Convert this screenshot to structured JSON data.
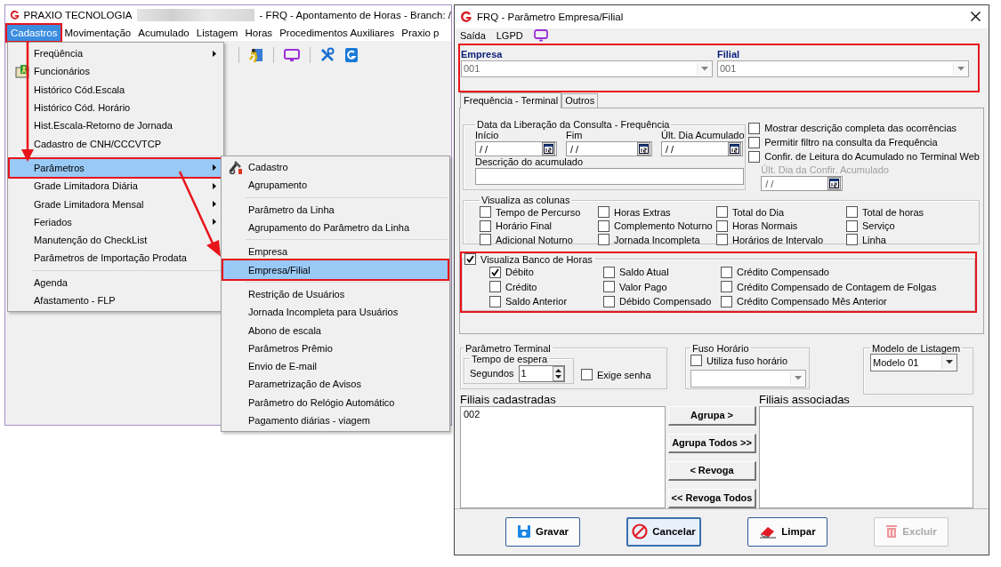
{
  "app": {
    "title": "PRAXIO TECNOLOGIA",
    "title_suffix": "- FRQ - Apontamento de Horas - Branch: /"
  },
  "menubar": [
    {
      "label": "Cadastros",
      "selected": true,
      "annotated": true
    },
    {
      "label": "Movimentação",
      "selected": false,
      "annotated": false
    },
    {
      "label": "Acumulado",
      "selected": false,
      "annotated": false
    },
    {
      "label": "Listagem",
      "selected": false,
      "annotated": false
    },
    {
      "label": "Horas",
      "selected": false,
      "annotated": false
    },
    {
      "label": "Procedimentos Auxiliares",
      "selected": false,
      "annotated": false
    },
    {
      "label": "Praxio p",
      "selected": false,
      "annotated": false
    }
  ],
  "menu": {
    "items": [
      {
        "kind": "item",
        "label": "Freqüência",
        "has_submenu": true,
        "selected": false,
        "annotated": false
      },
      {
        "kind": "icon_item",
        "label": "Funcionários",
        "has_submenu": false,
        "selected": false,
        "annotated": false
      },
      {
        "kind": "item",
        "label": "Histórico Cód.Escala",
        "has_submenu": false,
        "selected": false,
        "annotated": false
      },
      {
        "kind": "item",
        "label": "Histórico Cód. Horário",
        "has_submenu": false,
        "selected": false,
        "annotated": false
      },
      {
        "kind": "item",
        "label": "Hist.Escala-Retorno de Jornada",
        "has_submenu": false,
        "selected": false,
        "annotated": false
      },
      {
        "kind": "item",
        "label": "Cadastro de CNH/CCCVTCP",
        "has_submenu": false,
        "selected": false,
        "annotated": false
      },
      {
        "kind": "separator"
      },
      {
        "kind": "item",
        "label": "Parâmetros",
        "has_submenu": true,
        "selected": true,
        "annotated": true
      },
      {
        "kind": "item",
        "label": "Grade Limitadora Diária",
        "has_submenu": true,
        "selected": false,
        "annotated": false
      },
      {
        "kind": "item",
        "label": "Grade Limitadora Mensal",
        "has_submenu": true,
        "selected": false,
        "annotated": false
      },
      {
        "kind": "item",
        "label": "Feriados",
        "has_submenu": true,
        "selected": false,
        "annotated": false
      },
      {
        "kind": "item",
        "label": "Manutenção do CheckList",
        "has_submenu": false,
        "selected": false,
        "annotated": false
      },
      {
        "kind": "item",
        "label": "Parâmetros de Importação Prodata",
        "has_submenu": false,
        "selected": false,
        "annotated": false
      },
      {
        "kind": "separator"
      },
      {
        "kind": "item",
        "label": "Agenda",
        "has_submenu": false,
        "selected": false,
        "annotated": false
      },
      {
        "kind": "item",
        "label": "Afastamento - FLP",
        "has_submenu": false,
        "selected": false,
        "annotated": false
      }
    ]
  },
  "submenu": {
    "items": [
      {
        "kind": "icon_item",
        "label": "Cadastro",
        "selected": false,
        "annotated": false
      },
      {
        "kind": "item",
        "label": "Agrupamento",
        "selected": false,
        "annotated": false
      },
      {
        "kind": "separator"
      },
      {
        "kind": "item",
        "label": "Parâmetro da Linha",
        "selected": false,
        "annotated": false
      },
      {
        "kind": "item",
        "label": "Agrupamento do Parâmetro da Linha",
        "selected": false,
        "annotated": false
      },
      {
        "kind": "separator"
      },
      {
        "kind": "item",
        "label": "Empresa",
        "selected": false,
        "annotated": false
      },
      {
        "kind": "item",
        "label": "Empresa/Filial",
        "selected": true,
        "annotated": true
      },
      {
        "kind": "separator"
      },
      {
        "kind": "item",
        "label": "Restrição de Usuários",
        "selected": false,
        "annotated": false
      },
      {
        "kind": "item",
        "label": "Jornada Incompleta para Usuários",
        "selected": false,
        "annotated": false
      },
      {
        "kind": "item",
        "label": "Abono de escala",
        "selected": false,
        "annotated": false
      },
      {
        "kind": "item",
        "label": "Parâmetros Prêmio",
        "selected": false,
        "annotated": false
      },
      {
        "kind": "item",
        "label": "Envio de E-mail",
        "selected": false,
        "annotated": false
      },
      {
        "kind": "item",
        "label": "Parametrização de Avisos",
        "selected": false,
        "annotated": false
      },
      {
        "kind": "item",
        "label": "Parâmetro do Relógio Automático",
        "selected": false,
        "annotated": false
      },
      {
        "kind": "item",
        "label": "Pagamento diárias - viagem",
        "selected": false,
        "annotated": false
      }
    ]
  },
  "dialog": {
    "title": "FRQ - Parâmetro Empresa/Filial",
    "menu": [
      "Saída",
      "LGPD"
    ],
    "company_group": {
      "annotated": true,
      "fields": [
        {
          "label": "Empresa",
          "value": "001",
          "disabled": true
        },
        {
          "label": "Filial",
          "value": "001",
          "disabled": true
        }
      ]
    },
    "tabs": [
      {
        "label": "Frequência - Terminal",
        "selected": true
      },
      {
        "label": "Outros",
        "selected": false
      }
    ],
    "liberacao": {
      "title": "Data da Liberação da Consulta  - Frequência",
      "dates": [
        {
          "label": "Início",
          "value": "/ /"
        },
        {
          "label": "Fim",
          "value": "/ /"
        },
        {
          "label": "Últ. Dia Acumulado",
          "value": "/ /"
        }
      ],
      "descricao_label": "Descrição do acumulado"
    },
    "options": [
      {
        "label": "Mostrar descrição completa das ocorrências",
        "checked": false
      },
      {
        "label": "Permitir filtro na consulta da Frequência",
        "checked": false
      },
      {
        "label": "Confir. de Leitura do Acumulado no Terminal Web",
        "checked": false
      }
    ],
    "confirmacao": {
      "label": "Últ. Dia da Confir. Acumulado",
      "value": "/ /",
      "disabled": true
    },
    "colunas": {
      "title": "Visualiza as colunas",
      "columns": [
        {
          "items": [
            {
              "label": "Tempo de Percurso",
              "checked": false
            },
            {
              "label": "Horário Final",
              "checked": false
            },
            {
              "label": "Adicional Noturno",
              "checked": false
            }
          ]
        },
        {
          "items": [
            {
              "label": "Horas Extras",
              "checked": false
            },
            {
              "label": "Complemento Noturno",
              "checked": false
            },
            {
              "label": "Jornada Incompleta",
              "checked": false
            }
          ]
        },
        {
          "items": [
            {
              "label": "Total do Dia",
              "checked": false
            },
            {
              "label": "Horas Normais",
              "checked": false
            },
            {
              "label": "Horários de Intervalo",
              "checked": false
            }
          ]
        },
        {
          "items": [
            {
              "label": "Total de horas",
              "checked": false
            },
            {
              "label": "Serviço",
              "checked": false
            },
            {
              "label": "Linha",
              "checked": false
            }
          ]
        }
      ]
    },
    "banco": {
      "label": "Visualiza Banco de Horas",
      "checked": true,
      "annotated": true,
      "columns": [
        {
          "items": [
            {
              "label": "Débito",
              "checked": true
            },
            {
              "label": "Crédito",
              "checked": false
            },
            {
              "label": "Saldo Anterior",
              "checked": false
            }
          ]
        },
        {
          "items": [
            {
              "label": "Saldo Atual",
              "checked": false
            },
            {
              "label": "Valor Pago",
              "checked": false
            },
            {
              "label": "Débido Compensado",
              "checked": false
            }
          ]
        },
        {
          "items": [
            {
              "label": "Crédito Compensado",
              "checked": false
            },
            {
              "label": "Crédito Compensado de Contagem de Folgas",
              "checked": false
            },
            {
              "label": "Crédito Compensado Mês Anterior",
              "checked": false
            }
          ]
        }
      ]
    },
    "terminal": {
      "title": "Parâmetro Terminal",
      "tempo_title": "Tempo de espera",
      "segundos_label": "Segundos",
      "segundos_value": "1",
      "exige_senha": {
        "label": "Exige senha",
        "checked": false
      }
    },
    "fuso": {
      "title": "Fuso Horário",
      "label": "Utiliza fuso horário",
      "checked": false
    },
    "modelo": {
      "title": "Modelo de Listagem",
      "value": "Modelo 01"
    },
    "cadastradas": {
      "label": "Filiais cadastradas",
      "items": [
        "002"
      ]
    },
    "transfer_buttons": [
      "Agrupa >",
      "Agrupa Todos >>",
      "< Revoga",
      "<< Revoga Todos"
    ],
    "associadas": {
      "label": "Filiais associadas"
    },
    "buttons": [
      {
        "kind": "save",
        "label": "Gravar",
        "disabled": false,
        "focused": false
      },
      {
        "kind": "cancel",
        "label": "Cancelar",
        "disabled": false,
        "focused": true
      },
      {
        "kind": "clear",
        "label": "Limpar",
        "disabled": false,
        "focused": false
      },
      {
        "kind": "delete",
        "label": "Excluir",
        "disabled": true,
        "focused": false
      }
    ]
  }
}
